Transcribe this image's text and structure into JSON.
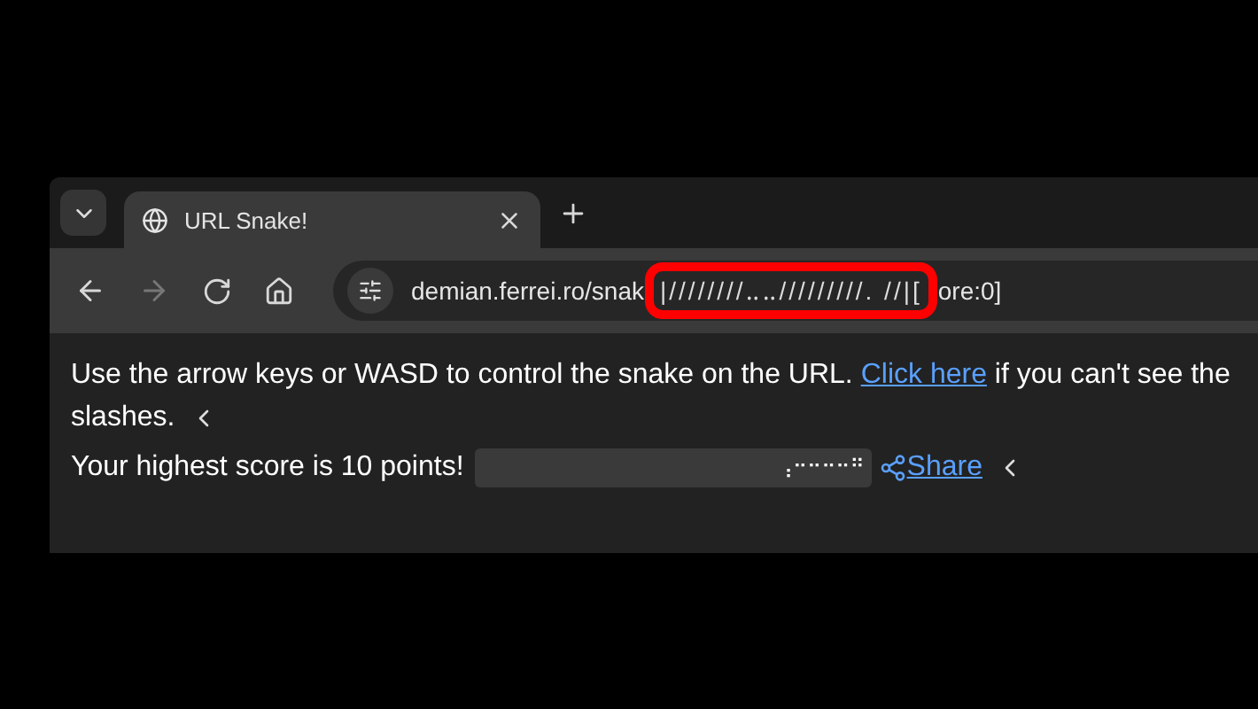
{
  "tabs": [
    {
      "title": "URL Snake!",
      "selected": true
    }
  ],
  "toolbar": {
    "forward_disabled": true
  },
  "address_bar": {
    "url_start": "demian.ferrei.ro/snak",
    "highlighted": "|////////‥‥/////////. //|[",
    "url_end": "ore:0]"
  },
  "content": {
    "instructions": {
      "before": "Use the arrow keys or WASD to control the snake on the URL.",
      "link": "Click here",
      "after": "if you can't see the",
      "continuation": "slashes."
    },
    "score_text": "Your highest score is 10 points!",
    "snake_preview": "⢠⠒⠒⠒⠒⠛",
    "share_link": "Share"
  }
}
